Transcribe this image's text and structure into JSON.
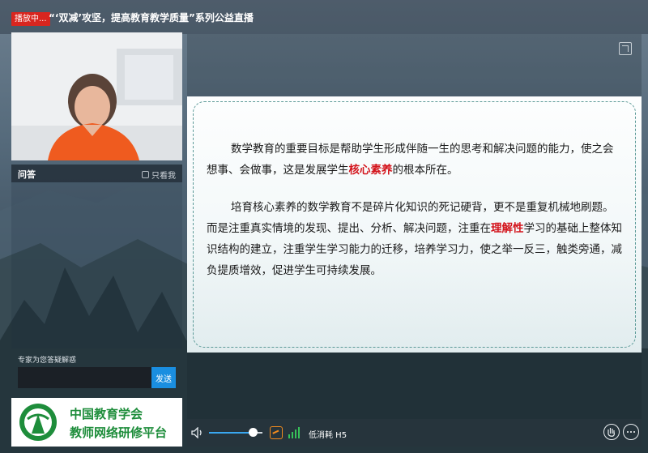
{
  "header": {
    "live_badge": "播放中...",
    "title": "“‘双减’攻坚，提高教育教学质量”系列公益直播"
  },
  "qa": {
    "title": "问答",
    "only_me_label": "只看我",
    "hint": "专家为您答疑解惑",
    "input_value": "",
    "send_label": "发送"
  },
  "logo": {
    "line1": "中国教育学会",
    "line2": "教师网络研修平台"
  },
  "slide": {
    "p1_before": "数学教育的重要目标是帮助学生形成伴随一生的思考和解决问题的能力，使之会想事、会做事，这是发展学生",
    "p1_highlight": "核心素养",
    "p1_after": "的根本所在。",
    "p2_before": "培育核心素养的数学教育不是碎片化知识的死记硬背，更不是重复机械地刷题。而是注重真实情境的发现、提出、分析、解决问题，注重在",
    "p2_highlight": "理解性",
    "p2_after": "学习的基础上整体知识结构的建立，注重学生学习能力的迁移，培养学习力，使之举一反三，触类旁通，减负提质增效，促进学生可持续发展。",
    "highlight_color": "#d3141c"
  },
  "controls": {
    "volume_fraction": 0.82,
    "mode_label": "低消耗 H5"
  },
  "colors": {
    "accent": "#1a8ee0",
    "live": "#d8261f",
    "logo_green": "#1e8d3b"
  }
}
